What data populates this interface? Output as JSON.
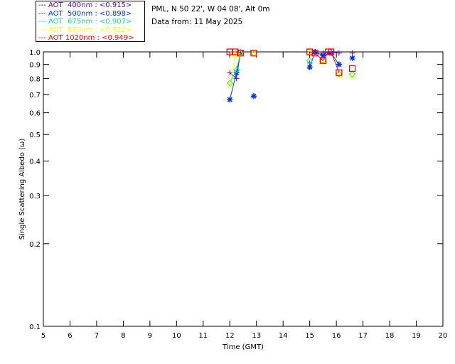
{
  "header": {
    "site": "PML, N 50 22', W 04 08', Alt 0m",
    "date": "Data from: 11 May 2025"
  },
  "chart_data": {
    "type": "scatter",
    "xlabel": "Time (GMT)",
    "ylabel": "Single Scattering Albedo (ω)",
    "xlim": [
      5,
      20
    ],
    "ylim": [
      0.1,
      1.0
    ],
    "yscale": "log",
    "legend_position": "top-left",
    "xticks": [
      "5",
      "6",
      "7",
      "8",
      "9",
      "10",
      "11",
      "12",
      "13",
      "14",
      "15",
      "16",
      "17",
      "18",
      "19",
      "20"
    ],
    "yticks": [
      {
        "v": 0.1,
        "label": "0.1"
      },
      {
        "v": 0.2,
        "label": "0.2"
      },
      {
        "v": 0.3,
        "label": "0.3"
      },
      {
        "v": 0.4,
        "label": "0.4"
      },
      {
        "v": 0.5,
        "label": "0.5"
      },
      {
        "v": 0.6,
        "label": "0.6"
      },
      {
        "v": 0.7,
        "label": "0.7"
      },
      {
        "v": 0.8,
        "label": "0.8"
      },
      {
        "v": 0.9,
        "label": "0.9"
      },
      {
        "v": 1.0,
        "label": "1.0"
      }
    ],
    "series": [
      {
        "name": "AOT  400nm : <0.915>",
        "color": "#6a00aa",
        "marker": "plus",
        "x": [
          12.0,
          12.25,
          12.4,
          15.0,
          15.5,
          15.8,
          16.1,
          16.6
        ],
        "y": [
          0.84,
          0.8,
          1.0,
          0.91,
          0.99,
          1.0,
          0.99,
          0.99
        ]
      },
      {
        "name": "AOT  500nm : <0.898>",
        "color": "#0033ff",
        "marker": "star",
        "x": [
          12.0,
          12.25,
          12.4,
          12.9,
          15.0,
          15.2,
          15.5,
          15.8,
          16.1,
          16.6
        ],
        "y": [
          0.67,
          0.84,
          0.99,
          0.69,
          0.88,
          1.0,
          0.97,
          0.99,
          0.9,
          0.95
        ]
      },
      {
        "name": "AOT  675nm : <0.907>",
        "color": "#00ee77",
        "marker": "diamond",
        "x": [
          12.0,
          12.25,
          12.4,
          12.9,
          15.0,
          15.5,
          16.1,
          16.6
        ],
        "y": [
          0.77,
          0.86,
          0.99,
          0.99,
          0.93,
          0.93,
          0.83,
          0.83
        ]
      },
      {
        "name": "AOT  870nm : <0.922>",
        "color": "#ffff00",
        "marker": "triangle",
        "x": [
          12.0,
          12.2,
          12.4,
          12.9,
          15.0,
          15.5,
          16.1,
          16.6
        ],
        "y": [
          0.76,
          0.97,
          0.99,
          0.99,
          1.0,
          0.92,
          0.82,
          0.82
        ]
      },
      {
        "name": "AOT 1020nm : <0.949>",
        "color": "#ff0000",
        "marker": "square",
        "x": [
          12.0,
          12.2,
          12.4,
          12.9,
          15.0,
          15.2,
          15.5,
          15.7,
          15.8,
          16.1,
          16.6
        ],
        "y": [
          1.0,
          1.0,
          0.99,
          0.99,
          1.0,
          0.99,
          0.93,
          1.0,
          1.0,
          0.84,
          0.87
        ]
      }
    ]
  }
}
